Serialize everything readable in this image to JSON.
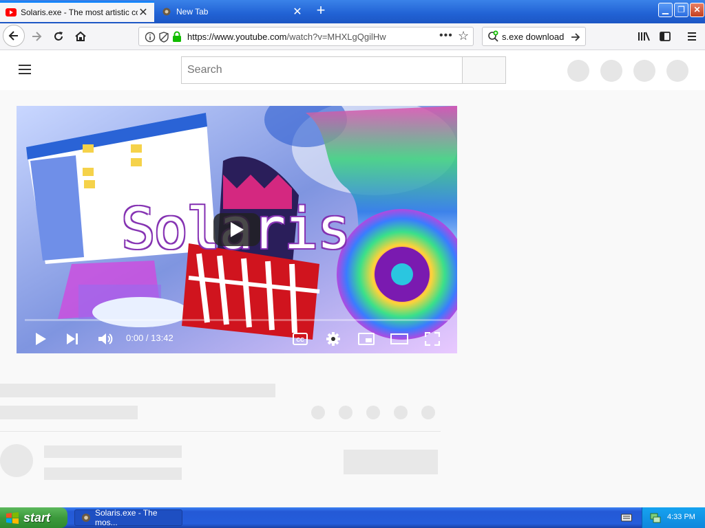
{
  "browser": {
    "tabs": [
      {
        "title": "Solaris.exe - The most artistic com",
        "active": true,
        "favicon": "youtube-icon"
      },
      {
        "title": "New Tab",
        "active": false,
        "favicon": "browser-icon"
      }
    ],
    "new_tab": "+",
    "url": {
      "host": "https://www.youtube.com",
      "path": "/watch?v=MHXLgQgilHw"
    },
    "search_value": "s.exe download",
    "colors": {
      "tabbar": "#2162d4",
      "accent": "#0a84ff",
      "secure": "#12bc00"
    }
  },
  "youtube": {
    "search_placeholder": "Search",
    "video": {
      "title_art": "Solaris",
      "time": "0:00 / 13:42",
      "played_fraction": 0
    },
    "colors": {
      "play_button": "#212121",
      "placeholder": "#e8e8e8"
    }
  },
  "taskbar": {
    "start_label": "start",
    "task_item": "Solaris.exe - The mos...",
    "clock": "4:33 PM",
    "colors": {
      "bar": "#245ddb",
      "start": "#3c9a3c",
      "tray": "#0f87dc"
    }
  }
}
